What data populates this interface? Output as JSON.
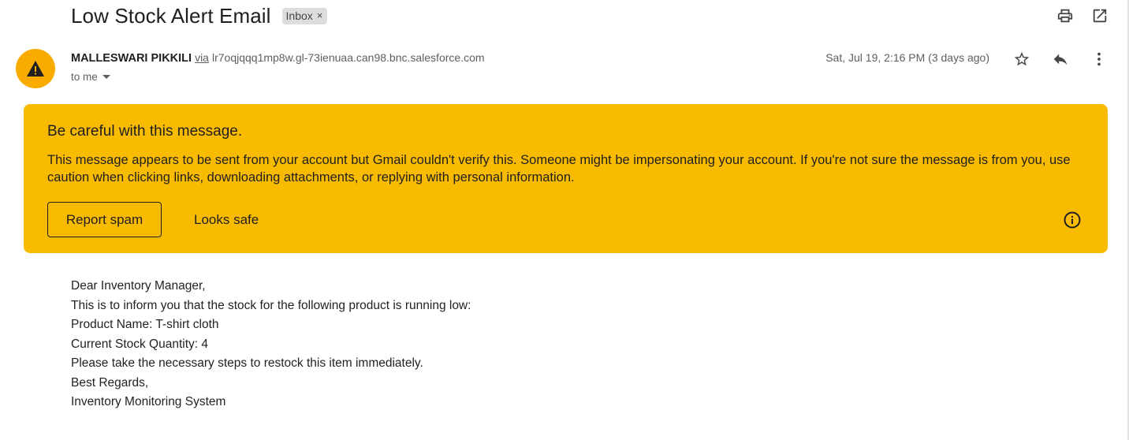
{
  "subject": "Low Stock Alert Email",
  "label": {
    "text": "Inbox",
    "remove": "×"
  },
  "sender": {
    "name": "MALLESWARI PIKKILI",
    "via": "via",
    "domain": "lr7oqjqqq1mp8w.gl-73ienuaa.can98.bnc.salesforce.com",
    "to": "to me",
    "date": "Sat, Jul 19, 2:16 PM (3 days ago)"
  },
  "icons": {
    "print": "print-icon",
    "open_new_window": "open-in-new-window-icon",
    "star": "star-icon",
    "reply": "reply-icon",
    "more": "more-vert-icon",
    "avatar": "warning-icon",
    "info": "info-icon"
  },
  "banner": {
    "title": "Be careful with this message.",
    "text": "This message appears to be sent from your account but Gmail couldn't verify this. Someone might be impersonating your account. If you're not sure the message is from you, use caution when clicking links, downloading attachments, or replying with personal information.",
    "report_label": "Report spam",
    "safe_label": "Looks safe",
    "color": "#f9bb00"
  },
  "body_lines": [
    "Dear Inventory Manager,",
    "This is to inform you that the stock for the following product is running low:",
    "Product Name: T-shirt cloth",
    "Current Stock Quantity: 4",
    "Please take the necessary steps to restock this item immediately.",
    "Best Regards,",
    "Inventory Monitoring System"
  ]
}
